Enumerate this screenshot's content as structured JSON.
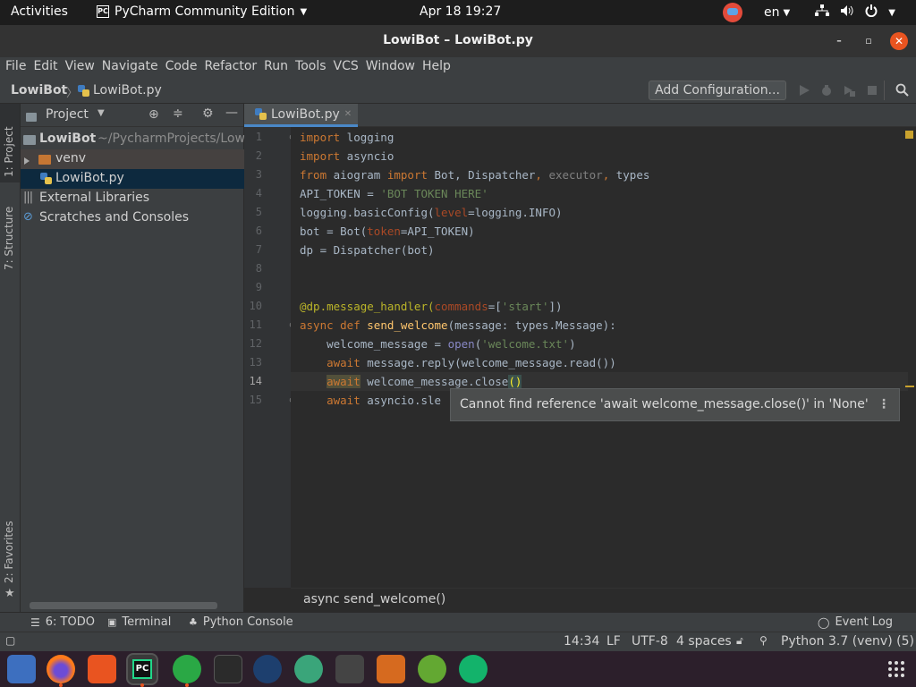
{
  "topbar": {
    "activities": "Activities",
    "app_name": "PyCharm Community Edition",
    "clock": "Apr 18  19:27",
    "language": "en"
  },
  "window": {
    "title": "LowiBot – LowiBot.py"
  },
  "menu": [
    "File",
    "Edit",
    "View",
    "Navigate",
    "Code",
    "Refactor",
    "Run",
    "Tools",
    "VCS",
    "Window",
    "Help"
  ],
  "navbar": {
    "project": "LowiBot",
    "file": "LowiBot.py",
    "add_configuration": "Add Configuration..."
  },
  "left_strip": {
    "project_tab": "1: Project",
    "structure_tab": "7: Structure",
    "favorites_tab": "2: Favorites"
  },
  "project_panel": {
    "title": "Project",
    "root_name": "LowiBot",
    "root_path": "~/PycharmProjects/Low",
    "venv": "venv",
    "file": "LowiBot.py",
    "external_libraries": "External Libraries",
    "scratches": "Scratches and Consoles"
  },
  "editor": {
    "tab_label": "LowiBot.py",
    "line_numbers": [
      "1",
      "2",
      "3",
      "4",
      "5",
      "6",
      "7",
      "8",
      "9",
      "10",
      "11",
      "12",
      "13",
      "14",
      "15"
    ],
    "tooltip": "Cannot find reference 'await welcome_message.close()' in 'None'",
    "bottom_breadcrumb": "async send_welcome()"
  },
  "bottom_tools": {
    "todo": "6: TODO",
    "terminal": "Terminal",
    "python_console": "Python Console",
    "event_log": "Event Log"
  },
  "status": {
    "position": "14:34",
    "line_sep": "LF",
    "encoding": "UTF-8",
    "indent": "4 spaces",
    "interpreter": "Python 3.7 (venv) (5)"
  },
  "colors": {
    "accent": "#4a88c7",
    "ubuntu_orange": "#e95420",
    "editor_bg": "#2b2b2b",
    "panel_bg": "#3c3f41"
  }
}
